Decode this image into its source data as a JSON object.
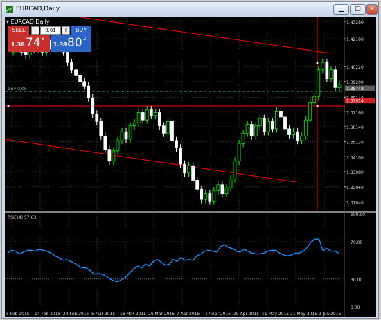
{
  "window": {
    "title": "EURCAD,Daily",
    "minimize_glyph": "▁",
    "maximize_glyph": "□",
    "close_glyph": "✕"
  },
  "chart": {
    "label": "EURCAD,Daily",
    "pending_order_label": "buy 0.08",
    "indicator_label": "RSI(14) 57.63"
  },
  "trade_panel": {
    "sell_label": "SELL",
    "buy_label": "BUY",
    "lot": "0.01",
    "dec_glyph": "-",
    "inc_glyph": "+",
    "sell_small": "1.38",
    "sell_big": "74",
    "sell_sup": "8",
    "buy_small": "1.38",
    "buy_big": "80",
    "buy_sup": "2"
  },
  "colors": {
    "background": "#000000",
    "bull": "#00ff00",
    "bear": "#ffffff",
    "rsi": "#1e90ff",
    "trendline": "#ff0000"
  },
  "price_axis": [
    "1.43280",
    "1.42100",
    "1.40220",
    "1.39200",
    "1.38140",
    "1.37160",
    "1.36140",
    "1.35120",
    "1.34100",
    "1.33080",
    "1.32060",
    "1.31040"
  ],
  "price_tags": [
    "1.38748",
    "1.37914"
  ],
  "rsi_axis": [
    "100.00",
    "70.00",
    "30.00",
    "0.00"
  ],
  "date_axis": [
    "5 Feb 2015",
    "14 Feb 2015",
    "24 Feb 2015",
    "5 Mar 2015",
    "16 Mar 2015",
    "26 Mar 2015",
    "7 Apr 2015",
    "17 Apr 2015",
    "29 Apr 2015",
    "11 May 2015",
    "21 May 2015",
    "2 Jun 2015"
  ],
  "chart_data": {
    "type": "candlestick",
    "candles_close": [
      1.414,
      1.417,
      1.412,
      1.41,
      1.415,
      1.414,
      1.418,
      1.412,
      1.42,
      1.414,
      1.419,
      1.418,
      1.412,
      1.405,
      1.4,
      1.396,
      1.392,
      1.389,
      1.381,
      1.37,
      1.365,
      1.355,
      1.346,
      1.338,
      1.345,
      1.352,
      1.358,
      1.353,
      1.362,
      1.364,
      1.371,
      1.366,
      1.373,
      1.369,
      1.371,
      1.362,
      1.357,
      1.365,
      1.352,
      1.347,
      1.336,
      1.33,
      1.335,
      1.325,
      1.319,
      1.312,
      1.316,
      1.311,
      1.318,
      1.322,
      1.316,
      1.32,
      1.326,
      1.338,
      1.35,
      1.357,
      1.363,
      1.355,
      1.362,
      1.367,
      1.358,
      1.365,
      1.36,
      1.372,
      1.368,
      1.36,
      1.356,
      1.358,
      1.352,
      1.355,
      1.366,
      1.378,
      1.382,
      1.4,
      1.405,
      1.394,
      1.4,
      1.388,
      1.39
    ],
    "rsi_values": [
      58,
      61,
      60,
      57,
      59,
      61,
      61,
      60,
      62,
      61,
      60,
      58,
      55,
      53,
      50,
      51,
      49,
      47,
      44,
      42,
      42,
      39,
      35,
      36,
      35,
      33,
      30,
      28,
      27,
      30,
      32,
      37,
      41,
      44,
      42,
      46,
      44,
      49,
      51,
      48,
      45,
      46,
      51,
      49,
      53,
      50,
      51,
      50,
      55,
      57,
      60,
      61,
      60,
      59,
      65,
      67,
      64,
      63,
      60,
      59,
      62,
      60,
      58,
      57,
      57,
      58,
      60,
      61,
      61,
      58,
      56,
      55,
      56,
      58,
      58,
      60,
      64,
      70,
      73,
      73,
      61,
      63,
      60,
      60,
      58
    ],
    "rsi_levels": [
      70,
      30
    ],
    "rsi_range": [
      0,
      100
    ]
  }
}
